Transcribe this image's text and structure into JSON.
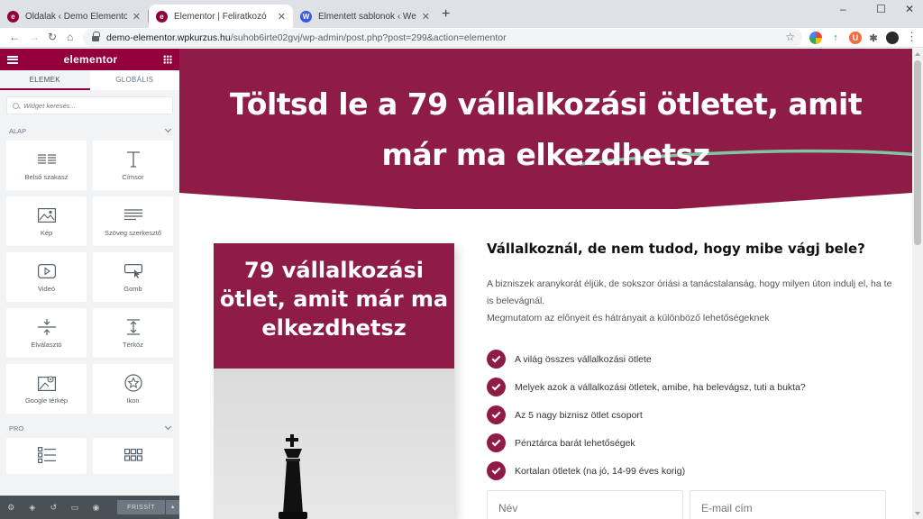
{
  "browser": {
    "tabs": [
      {
        "title": "Oldalak ‹ Demo Elementor — W…",
        "icon": "elementor-favicon",
        "active": false
      },
      {
        "title": "Elementor | Feliratkozó",
        "icon": "elementor-favicon",
        "active": true
      },
      {
        "title": "Elmentett sablonok ‹ Webreviszi…",
        "icon": "wordpress-favicon",
        "active": false
      }
    ],
    "tab_close": "✕",
    "new_tab": "+",
    "url_host": "demo-elementor.wpkurzus.hu",
    "url_path": "/suhob6irte02gvj/wp-admin/post.php?post=299&action=elementor",
    "extension_letter": "U",
    "window_controls": {
      "minimize": "–",
      "maximize": "☐",
      "close": "✕"
    }
  },
  "panel": {
    "brand": "elementor",
    "tabs": [
      "ELEMEK",
      "GLOBÁLIS"
    ],
    "search_placeholder": "Widget keresés...",
    "categories": {
      "basic": "ALAP",
      "pro": "PRO"
    },
    "widgets": [
      {
        "label": "Belső szakasz",
        "icon": "inner-section-icon"
      },
      {
        "label": "Címsor",
        "icon": "heading-icon"
      },
      {
        "label": "Kép",
        "icon": "image-icon"
      },
      {
        "label": "Szöveg szerkesztő",
        "icon": "text-editor-icon"
      },
      {
        "label": "Videó",
        "icon": "video-icon"
      },
      {
        "label": "Gomb",
        "icon": "button-icon"
      },
      {
        "label": "Elválasztó",
        "icon": "divider-icon"
      },
      {
        "label": "Térköz",
        "icon": "spacer-icon"
      },
      {
        "label": "Google térkép",
        "icon": "map-icon"
      },
      {
        "label": "Ikon",
        "icon": "star-icon"
      }
    ],
    "publish_label": "FRISSÍT"
  },
  "page": {
    "hero_title_pre": "Töltsd le a ",
    "hero_title_highlight": "79 vállalkozási ötletet",
    "hero_title_post": ", amit",
    "hero_title_line2": "már ma elkezdhetsz",
    "book_title": "79 vállalkozási ötlet, amit már ma elkezdhetsz",
    "subheading": "Vállalkoznál, de nem tudod, hogy mibe vágj bele?",
    "description_1": "A bizniszek aranykorát éljük, de sokszor óriási a tanácstalanság, hogy milyen úton indulj el, ha te is belevágnál.",
    "description_2": "Megmutatom az előnyeit és hátrányait a különböző lehetőségeknek",
    "checklist": [
      "A világ összes vállalkozási ötlete",
      "Melyek azok a vállalkozási ötletek, amibe, ha belevágsz, tuti a bukta?",
      "Az 5 nagy biznisz ötlet csoport",
      "Pénztárca barát lehetőségek",
      "Kortalan ötletek (na jó, 14-99 éves korig)"
    ],
    "name_placeholder": "Név",
    "email_placeholder": "E-mail cím"
  },
  "colors": {
    "brand": "#93003c",
    "hero_bg": "#8e1c46",
    "accent_underline": "#7fc5a3"
  }
}
